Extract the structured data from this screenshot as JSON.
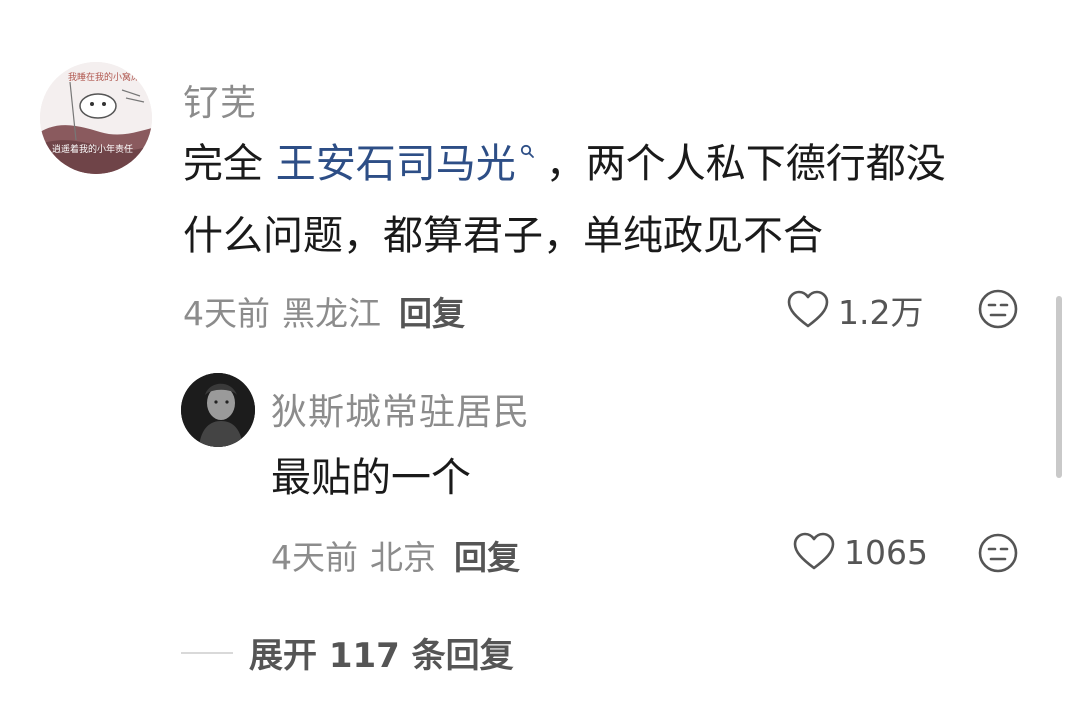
{
  "comment": {
    "avatar_text_top": "我睡在我的小窝床",
    "avatar_text_bottom": "逍遥着我的小年责任",
    "username": "钌芜",
    "text_before_link": "完全 ",
    "topic_link": "王安石司马光",
    "text_after_link": "，两个人私下德行都没",
    "text_line2": "什么问题，都算君子，单纯政见不合",
    "time": "4天前",
    "location": "黑龙江",
    "reply_label": "回复",
    "like_count": "1.2万"
  },
  "reply": {
    "username": "狄斯城常驻居民",
    "text": "最贴的一个",
    "time": "4天前",
    "location": "北京",
    "reply_label": "回复",
    "like_count": "1065"
  },
  "expand_label": "展开 117 条回复",
  "colors": {
    "link": "#2d4e86",
    "meta": "#8c8c8c",
    "text": "#1a1a1a"
  }
}
